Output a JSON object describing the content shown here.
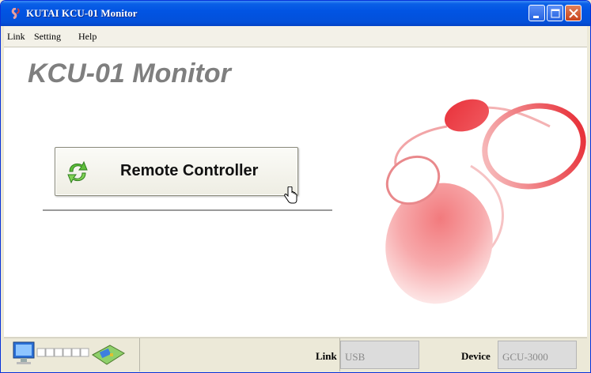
{
  "window": {
    "title": "KUTAI KCU-01 Monitor",
    "controls": [
      "minimize",
      "maximize",
      "close"
    ]
  },
  "menu": {
    "items": [
      "Link",
      "Setting",
      "Help"
    ]
  },
  "main": {
    "heading": "KCU-01 Monitor",
    "remote_button_label": "Remote Controller",
    "remote_button_icon": "refresh-icon"
  },
  "status": {
    "connection_icon": "computer-to-device-icon",
    "link_label": "Link",
    "link_value": "USB",
    "device_label": "Device",
    "device_value": "GCU-3000"
  },
  "colors": {
    "titlebar": "#0254e3",
    "decor_red": "#e8343c",
    "heading": "#7f7f7f"
  }
}
